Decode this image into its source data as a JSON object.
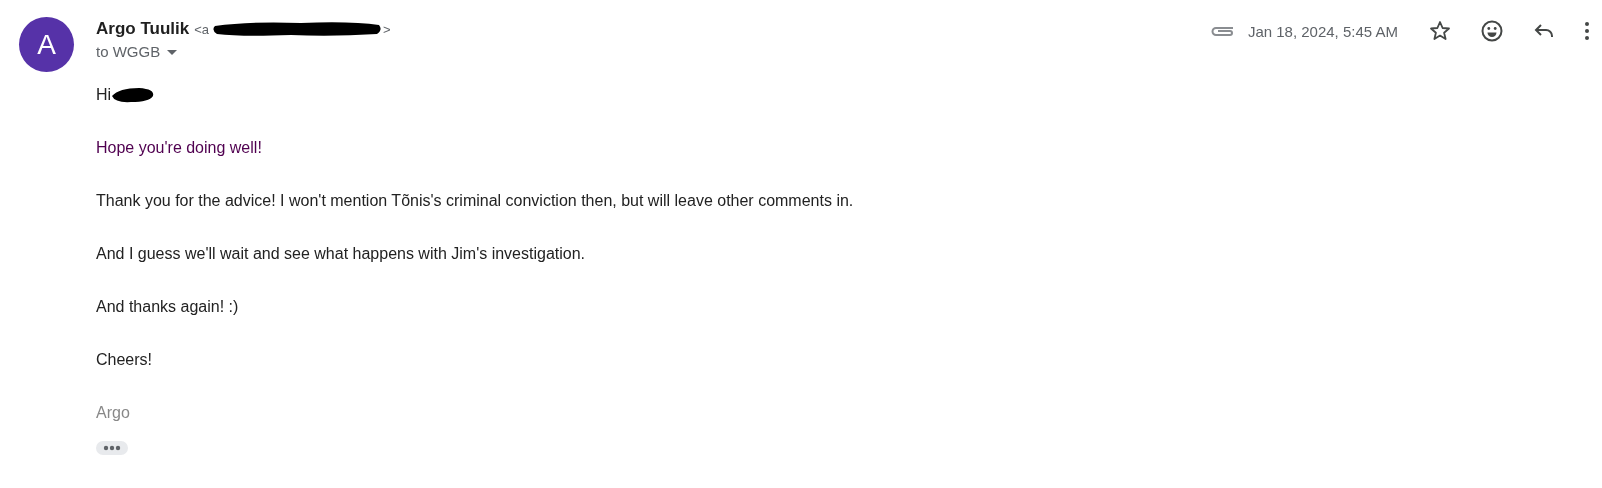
{
  "sender": {
    "avatar_letter": "A",
    "name": "Argo Tuulik",
    "email_start": "<a",
    "email_end": ">",
    "recipients": "to WGGB"
  },
  "header": {
    "date": "Jan 18, 2024, 5:45 AM",
    "has_attachment": true,
    "starred": false
  },
  "body": {
    "greeting": "Hi",
    "paragraphs": [
      {
        "text": "Hope you're doing well!",
        "kind": "highlight"
      },
      {
        "text": "Thank you for the advice! I won't mention Tõnis's criminal conviction then, but will leave other comments in.",
        "kind": "plain"
      },
      {
        "text": "And I guess we'll wait and see what happens with Jim's investigation.",
        "kind": "plain"
      },
      {
        "text": "And thanks again! :)",
        "kind": "plain"
      },
      {
        "text": "Cheers!",
        "kind": "plain"
      }
    ],
    "signature": "Argo"
  }
}
